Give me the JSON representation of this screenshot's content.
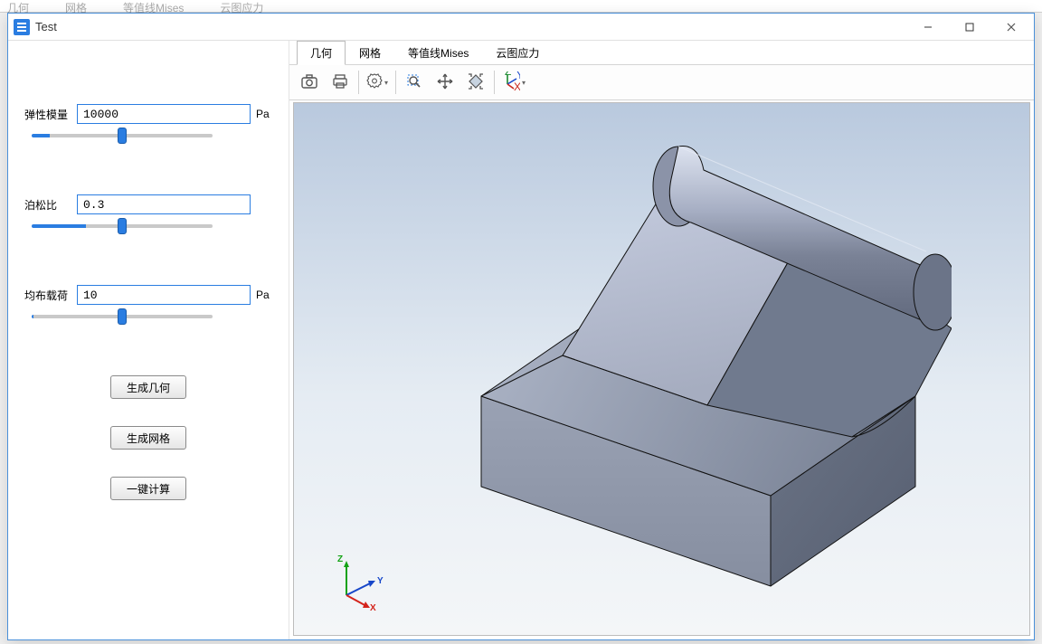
{
  "backdrop_tabs": [
    "几何",
    "网格",
    "等值线Mises",
    "云图应力"
  ],
  "window": {
    "title": "Test"
  },
  "params": {
    "elastic": {
      "label": "弹性模量",
      "value": "10000",
      "unit": "Pa",
      "slider_fill": "10%"
    },
    "poisson": {
      "label": "泊松比",
      "value": "0.3",
      "unit": "",
      "slider_fill": "30%"
    },
    "load": {
      "label": "均布载荷",
      "value": "10",
      "unit": "Pa",
      "slider_fill": "1%"
    }
  },
  "buttons": {
    "gen_geom": "生成几何",
    "gen_mesh": "生成网格",
    "one_click": "一键计算"
  },
  "tabs": [
    "几何",
    "网格",
    "等值线Mises",
    "云图应力"
  ],
  "active_tab": 0,
  "axes": {
    "x": "X",
    "y": "Y",
    "z": "Z"
  }
}
